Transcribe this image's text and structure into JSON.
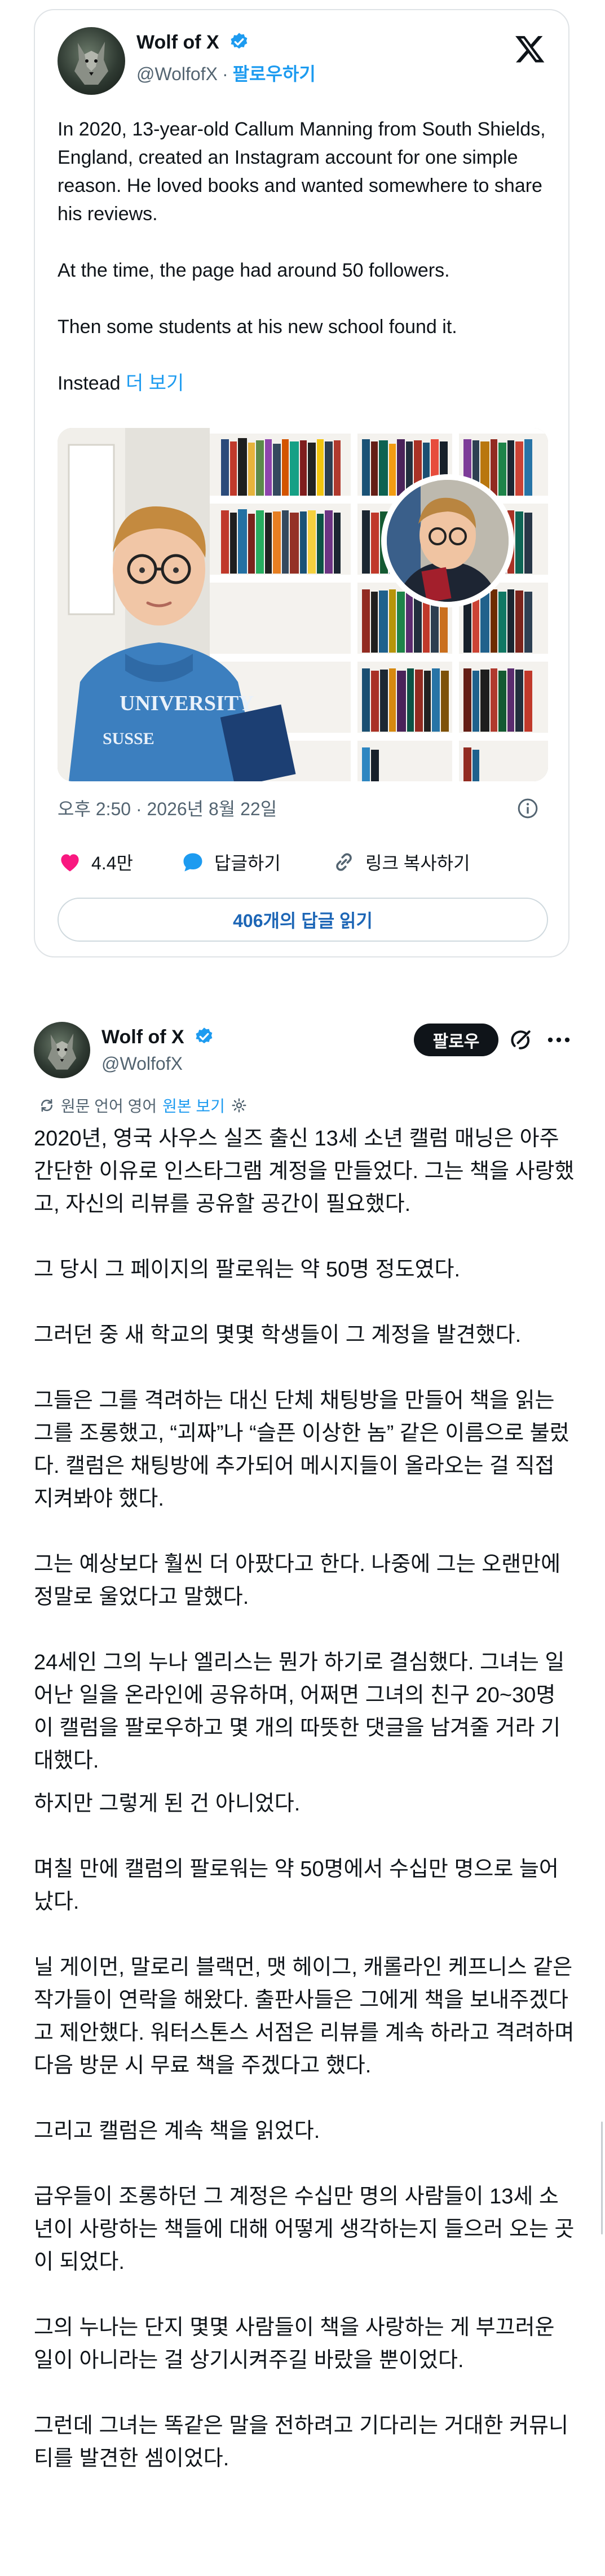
{
  "card": {
    "author_name": "Wolf of X",
    "author_handle": "@WolfofX",
    "handle_separator": "·",
    "follow_label": "팔로우하기",
    "paragraphs": [
      "In 2020, 13-year-old Callum Manning from South Shields, England, created an Instagram account for one simple reason. He loved books and wanted somewhere to share his reviews.",
      "At the time, the page had around 50 followers.",
      "Then some students at his new school found it."
    ],
    "last_line": "Instead",
    "more_label": "더 보기",
    "photo_shirt_text": "UNIVERSITY",
    "photo_shirt_text2": "SUSSE",
    "timestamp": "오후 2:50 · 2026년 8월 22일",
    "like_count": "4.4만",
    "reply_label": "답글하기",
    "copy_link_label": "링크 복사하기",
    "read_replies_label": "406개의 답글 읽기"
  },
  "post": {
    "author_name": "Wolf of X",
    "author_handle": "@WolfofX",
    "follow_label": "팔로우",
    "source_lang_label": "원문 언어 영어",
    "view_original_label": "원본 보기",
    "paragraphs": [
      "2020년, 영국 사우스 실즈 출신 13세 소년 캘럼 매닝은 아주 간단한 이유로 인스타그램 계정을 만들었다. 그는 책을 사랑했고, 자신의 리뷰를 공유할 공간이 필요했다.",
      "그 당시 그 페이지의 팔로워는 약 50명 정도였다.",
      "그러던 중 새 학교의 몇몇 학생들이 그 계정을 발견했다.",
      "그들은 그를 격려하는 대신 단체 채팅방을 만들어 책을 읽는 그를 조롱했고, “괴짜”나 “슬픈 이상한 놈” 같은 이름으로 불렀다. 캘럼은 채팅방에 추가되어 메시지들이 올라오는 걸 직접 지켜봐야 했다.",
      "그는 예상보다 훨씬 더 아팠다고 한다. 나중에 그는 오랜만에 정말로 울었다고 말했다.",
      "24세인 그의 누나 엘리스는 뭔가 하기로 결심했다. 그녀는 일어난 일을 온라인에 공유하며, 어쩌면 그녀의 친구 20~30명이 캘럼을 팔로우하고 몇 개의 따뜻한 댓글을 남겨줄 거라 기대했다.",
      "하지만 그렇게 된 건 아니었다.",
      "며칠 만에 캘럼의 팔로워는 약 50명에서 수십만 명으로 늘어났다.",
      "닐 게이먼, 말로리 블랙먼, 맷 헤이그, 캐롤라인 케프니스 같은 작가들이 연락을 해왔다. 출판사들은 그에게 책을 보내주겠다고 제안했다. 워터스톤스 서점은 리뷰를 계속 하라고 격려하며 다음 방문 시 무료 책을 주겠다고 했다.",
      "그리고 캘럼은 계속 책을 읽었다.",
      "급우들이 조롱하던 그 계정은 수십만 명의 사람들이 13세 소년이 사랑하는 책들에 대해 어떻게 생각하는지 들으러 오는 곳이 되었다.",
      "그의 누나는 단지 몇몇 사람들이 책을 사랑하는 게 부끄러운 일이 아니라는 걸 상기시켜주길 바랐을 뿐이었다.",
      "그런데 그녀는 똑같은 말을 전하려고 기다리는 거대한 커뮤니티를 발견한 셈이었다."
    ]
  },
  "colors": {
    "link_blue": "#1d9bf0",
    "like_pink": "#f91880",
    "reply_blue": "#1d9bf0",
    "text": "#0f1419",
    "muted": "#536471"
  },
  "icons": [
    "verified-badge-icon",
    "x-logo-icon",
    "info-icon",
    "heart-icon",
    "reply-bubble-icon",
    "link-icon",
    "grok-icon",
    "more-icon",
    "translate-icon",
    "settings-icon"
  ]
}
